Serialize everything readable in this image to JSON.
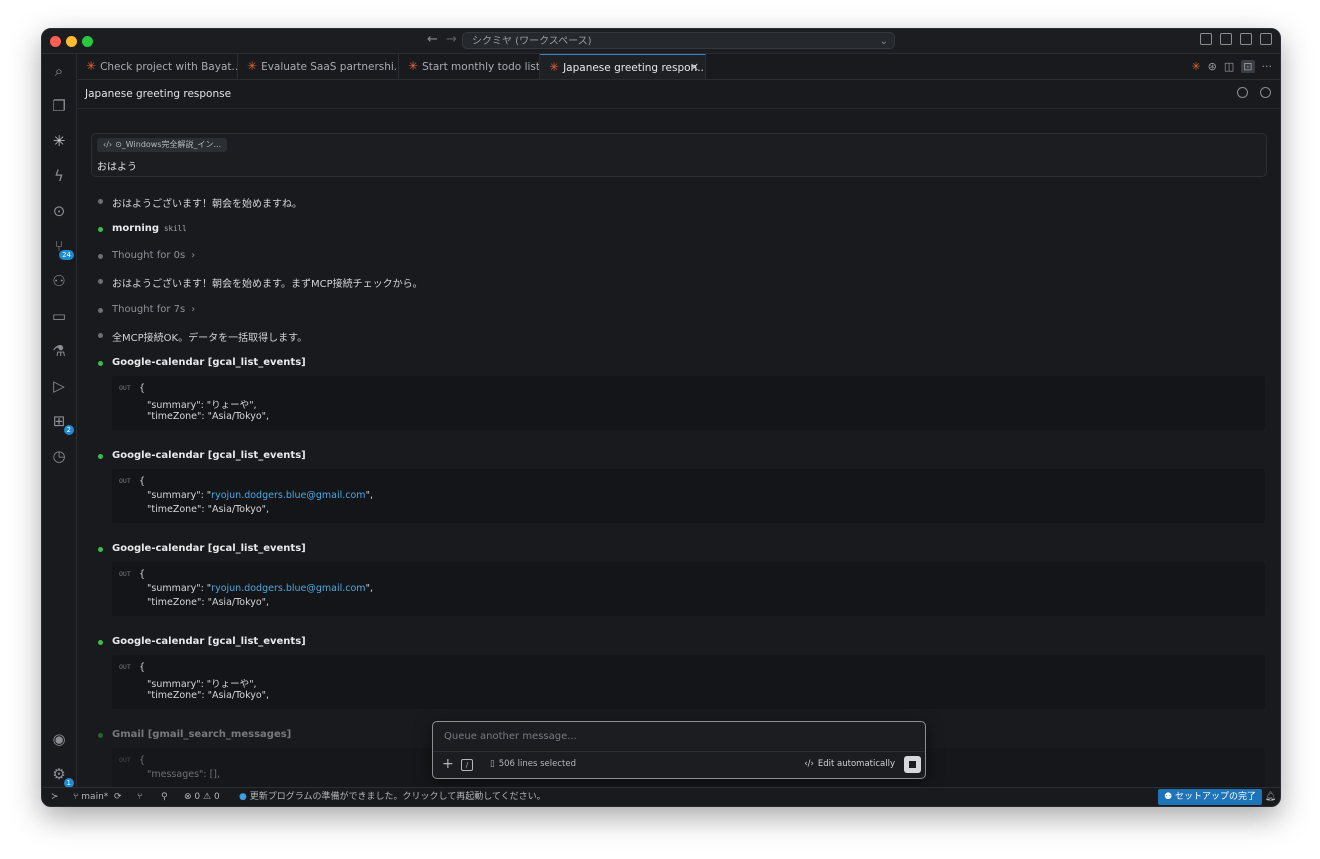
{
  "window": {
    "command_center": "シクミヤ (ワークスペース)"
  },
  "activity_bar": {
    "source_control_badge": "24",
    "extensions_badge": "2",
    "settings_badge": "1"
  },
  "tabs": [
    {
      "label": "Check project with Bayat..."
    },
    {
      "label": "Evaluate SaaS partnershi..."
    },
    {
      "label": "Start monthly todo list"
    },
    {
      "label": "Japanese greeting respon..."
    }
  ],
  "header": {
    "title": "Japanese greeting response"
  },
  "user_message": {
    "chip": "⊙_Windows完全解説_イン...",
    "text": "おはよう"
  },
  "messages": {
    "m1": "おはようございます！朝会を始めますね。",
    "m2_label": "morning",
    "m2_tag": "skill",
    "m3": "Thought for 0s",
    "m4": "おはようございます！朝会を始めます。まずMCP接続チェックから。",
    "m5": "Thought for 7s",
    "m6": "全MCP接続OK。データを一括取得します。"
  },
  "tool_calls": [
    {
      "title": "Google-calendar [gcal_list_events]",
      "out": "OUT",
      "l1": "{",
      "l2_key": "\"summary\": \"",
      "l2_val": "りょーや",
      "l2_end": "\",",
      "l3": "\"timeZone\": \"Asia/Tokyo\","
    },
    {
      "title": "Google-calendar [gcal_list_events]",
      "out": "OUT",
      "l1": "{",
      "l2_key": "\"summary\": \"",
      "l2_val": "ryojun.dodgers.blue@gmail.com",
      "l2_end": "\",",
      "l3": "\"timeZone\": \"Asia/Tokyo\","
    },
    {
      "title": "Google-calendar [gcal_list_events]",
      "out": "OUT",
      "l1": "{",
      "l2_key": "\"summary\": \"",
      "l2_val": "ryojun.dodgers.blue@gmail.com",
      "l2_end": "\",",
      "l3": "\"timeZone\": \"Asia/Tokyo\","
    },
    {
      "title": "Google-calendar [gcal_list_events]",
      "out": "OUT",
      "l1": "{",
      "l2_key": "\"summary\": \"",
      "l2_val": "りょーや",
      "l2_end": "\",",
      "l3": "\"timeZone\": \"Asia/Tokyo\","
    },
    {
      "title": "Gmail [gmail_search_messages]",
      "out": "OUT",
      "l1": "{",
      "l2_key": "\"messages\": [],",
      "l2_val": "",
      "l2_end": "",
      "l3": ""
    }
  ],
  "composer": {
    "placeholder": "Queue another message...",
    "lines_selected": "506 lines selected",
    "edit": "Edit automatically"
  },
  "statusbar": {
    "branch": "main*",
    "errors": "0",
    "warnings": "0",
    "message": "更新プログラムの準備ができました。クリックして再起動してください。",
    "setup": "セットアップの完了"
  }
}
